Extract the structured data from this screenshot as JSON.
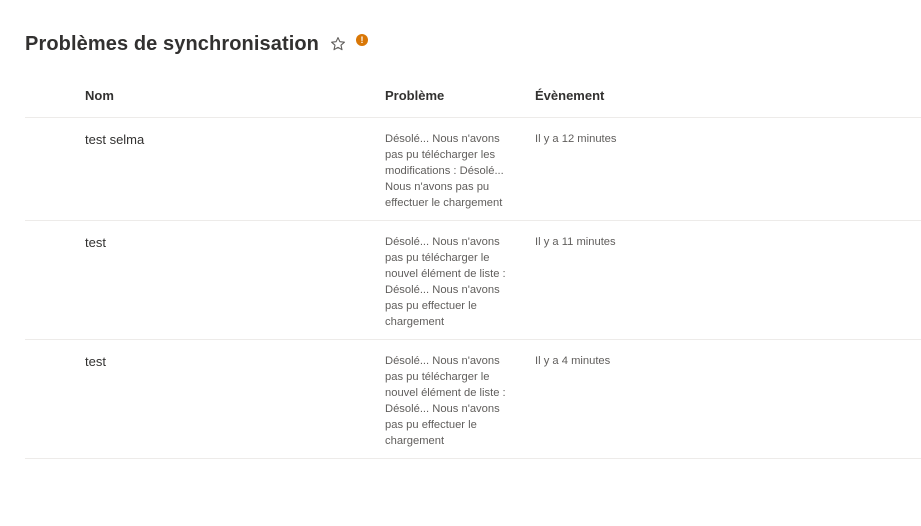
{
  "page": {
    "title": "Problèmes de synchronisation",
    "star_icon": "star-outline-icon",
    "warning_icon": "warning-dot-icon",
    "warning_glyph": "!",
    "warning_color": "#d97706"
  },
  "table": {
    "columns": {
      "name": "Nom",
      "problem": "Problème",
      "event": "Évènement"
    },
    "rows": [
      {
        "name": "test selma",
        "problem": "Désolé... Nous n'avons pas pu télécharger les modifications : Désolé... Nous n'avons pas pu effectuer le chargement",
        "event": "Il y a 12 minutes"
      },
      {
        "name": "test",
        "problem": "Désolé... Nous n'avons pas pu télécharger le nouvel élément de liste : Désolé... Nous n'avons pas pu effectuer le chargement",
        "event": "Il y a 11 minutes"
      },
      {
        "name": "test",
        "problem": "Désolé... Nous n'avons pas pu télécharger le nouvel élément de liste : Désolé... Nous n'avons pas pu effectuer le chargement",
        "event": "Il y a 4 minutes"
      }
    ]
  }
}
